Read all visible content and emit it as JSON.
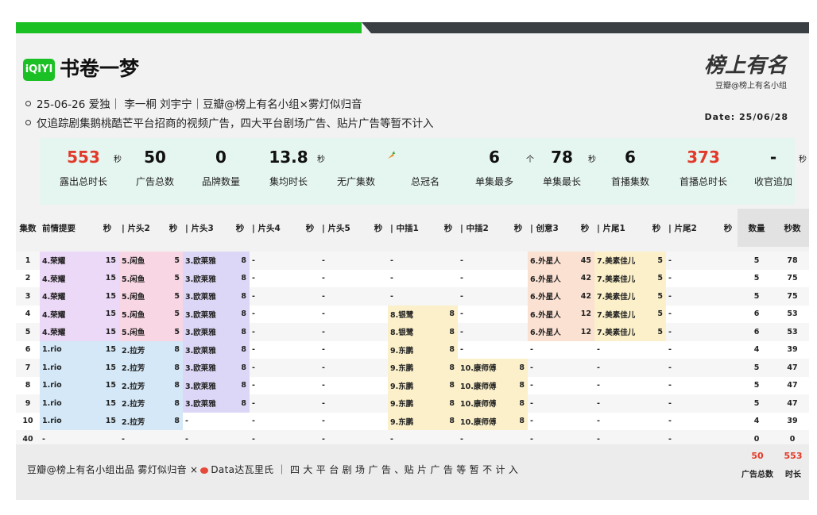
{
  "header": {
    "logo_text": "iQIYI",
    "title": "书卷一梦",
    "brand_calligraphy": "榜上有名",
    "brand_sub": "豆瓣@榜上有名小组",
    "info_line1": "25-06-26 爱独｜ 李一桐 刘宇宁｜豆瓣@榜上有名小组×雾灯似归音",
    "info_line2": "仅追踪剧集鹅桃酷芒平台招商的视频广告，四大平台剧场广告、贴片广告等暂不计入",
    "date": "Date: 25/06/28"
  },
  "stats": [
    {
      "value": "553",
      "unit": "秒",
      "label": "露出总时长",
      "red": true
    },
    {
      "value": "50",
      "unit": "",
      "label": "广告总数",
      "red": false
    },
    {
      "value": "0",
      "unit": "",
      "label": "品牌数量",
      "red": false
    },
    {
      "value": "13.8",
      "unit": "秒",
      "label": "集均时长",
      "red": false
    },
    {
      "value": "",
      "unit": "",
      "label": "无广集数",
      "red": false
    },
    {
      "value": "",
      "unit": "",
      "label": "总冠名",
      "red": false
    },
    {
      "value": "6",
      "unit": "个",
      "label": "单集最多",
      "red": false
    },
    {
      "value": "78",
      "unit": "秒",
      "label": "单集最长",
      "red": false
    },
    {
      "value": "6",
      "unit": "",
      "label": "首播集数",
      "red": false
    },
    {
      "value": "373",
      "unit": "",
      "label": "首播总时长",
      "red": true
    },
    {
      "value": "-",
      "unit": "秒",
      "label": "收官追加",
      "red": false
    }
  ],
  "table": {
    "headers": [
      "集数",
      "前情提要",
      "秒",
      "| 片头2",
      "秒",
      "| 片头3",
      "秒",
      "| 片头4",
      "秒",
      "| 片头5",
      "秒",
      "| 中插1",
      "秒",
      "| 中插2",
      "秒",
      "| 创意3",
      "秒",
      "| 片尾1",
      "秒",
      "| 片尾2",
      "秒",
      "数量",
      "秒数"
    ],
    "rows": [
      [
        "1",
        "4.荣耀",
        "15",
        "5.闲鱼",
        "5",
        "3.欧莱雅",
        "8",
        "-",
        "",
        "-",
        "",
        "-",
        "",
        "-",
        "",
        "6.外星人",
        "45",
        "7.美素佳儿",
        "5",
        "-",
        "",
        "5",
        "78"
      ],
      [
        "2",
        "4.荣耀",
        "15",
        "5.闲鱼",
        "5",
        "3.欧莱雅",
        "8",
        "-",
        "",
        "-",
        "",
        "-",
        "",
        "-",
        "",
        "6.外星人",
        "42",
        "7.美素佳儿",
        "5",
        "-",
        "",
        "5",
        "75"
      ],
      [
        "3",
        "4.荣耀",
        "15",
        "5.闲鱼",
        "5",
        "3.欧莱雅",
        "8",
        "-",
        "",
        "-",
        "",
        "-",
        "",
        "-",
        "",
        "6.外星人",
        "42",
        "7.美素佳儿",
        "5",
        "-",
        "",
        "5",
        "75"
      ],
      [
        "4",
        "4.荣耀",
        "15",
        "5.闲鱼",
        "5",
        "3.欧莱雅",
        "8",
        "-",
        "",
        "-",
        "",
        "8.银鹭",
        "8",
        "-",
        "",
        "6.外星人",
        "12",
        "7.美素佳儿",
        "5",
        "-",
        "",
        "6",
        "53"
      ],
      [
        "5",
        "4.荣耀",
        "15",
        "5.闲鱼",
        "5",
        "3.欧莱雅",
        "8",
        "-",
        "",
        "-",
        "",
        "8.银鹭",
        "8",
        "-",
        "",
        "6.外星人",
        "12",
        "7.美素佳儿",
        "5",
        "-",
        "",
        "6",
        "53"
      ],
      [
        "6",
        "1.rio",
        "15",
        "2.拉芳",
        "8",
        "3.欧莱雅",
        "8",
        "-",
        "",
        "-",
        "",
        "9.东鹏",
        "8",
        "-",
        "",
        "-",
        "",
        "-",
        "",
        "-",
        "",
        "4",
        "39"
      ],
      [
        "7",
        "1.rio",
        "15",
        "2.拉芳",
        "8",
        "3.欧莱雅",
        "8",
        "-",
        "",
        "-",
        "",
        "9.东鹏",
        "8",
        "10.康师傅",
        "8",
        "-",
        "",
        "-",
        "",
        "-",
        "",
        "5",
        "47"
      ],
      [
        "8",
        "1.rio",
        "15",
        "2.拉芳",
        "8",
        "3.欧莱雅",
        "8",
        "-",
        "",
        "-",
        "",
        "9.东鹏",
        "8",
        "10.康师傅",
        "8",
        "-",
        "",
        "-",
        "",
        "-",
        "",
        "5",
        "47"
      ],
      [
        "9",
        "1.rio",
        "15",
        "2.拉芳",
        "8",
        "3.欧莱雅",
        "8",
        "-",
        "",
        "-",
        "",
        "9.东鹏",
        "8",
        "10.康师傅",
        "8",
        "-",
        "",
        "-",
        "",
        "-",
        "",
        "5",
        "47"
      ],
      [
        "10",
        "1.rio",
        "15",
        "2.拉芳",
        "8",
        "-",
        "",
        "-",
        "",
        "-",
        "",
        "9.东鹏",
        "8",
        "10.康师傅",
        "8",
        "-",
        "",
        "-",
        "",
        "-",
        "",
        "4",
        "39"
      ],
      [
        "40",
        "-",
        "",
        "-",
        "",
        "-",
        "",
        "-",
        "",
        "-",
        "",
        "-",
        "",
        "-",
        "",
        "-",
        "",
        "-",
        "",
        "-",
        "",
        "0",
        "0"
      ]
    ],
    "brand_colors": {
      "荣耀": "#ecd8f7",
      "闲鱼": "#f8d6e3",
      "欧莱雅": "#dcd7f6",
      "rio": "#d4e8f7",
      "拉芳": "#d4e8f7",
      "银鹭": "#fbf0c9",
      "东鹏": "#fbf0c9",
      "康师傅": "#fbf0c9",
      "外星人": "#fbe1d2",
      "美素佳儿": "#fbf0c9"
    }
  },
  "footer": {
    "text_before": "豆瓣@榜上有名小组出品  雾灯似归音 ×",
    "text_after": "Data达瓦里氏 ｜ 四 大 平 台 剧 场 广 告 、贴 片 广 告 等 暂 不 计 入",
    "total_count": "50",
    "total_count_label": "广告总数",
    "total_time": "553",
    "total_time_label": "时长"
  },
  "colors": {
    "accent_green": "#1bc124",
    "highlight_red": "#e23a2a",
    "stats_bg": "#e5f5ef"
  }
}
